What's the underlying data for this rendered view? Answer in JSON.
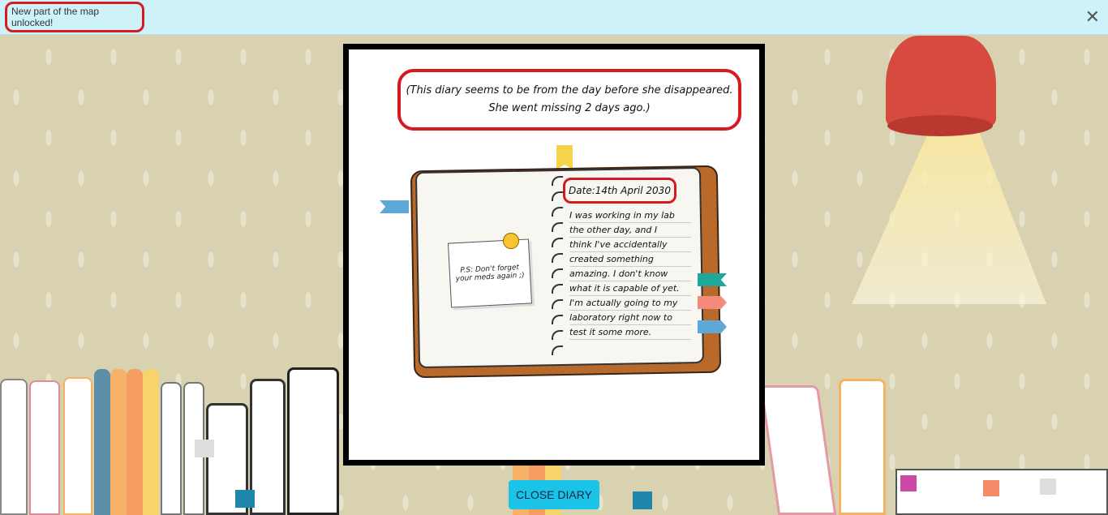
{
  "notification": {
    "text": "New part of the map unlocked!",
    "close_label": "✕"
  },
  "diary": {
    "intro_line1": "(This diary seems to be from the day before she disappeared.",
    "intro_line2": "She went missing 2 days ago.)",
    "sticky_note": "P.S: Don't forget your meds again ;)",
    "date": "Date:14th April 2030",
    "entry_lines": [
      "I was working in my lab",
      "the other day, and I",
      "think I've accidentally",
      "created something",
      "amazing. I don't know",
      "what it is capable of yet.",
      "I'm actually going to my",
      "laboratory right now to",
      "test it some more."
    ]
  },
  "buttons": {
    "close_diary": "CLOSE DIARY"
  },
  "colors": {
    "highlight": "#d71920",
    "banner_bg": "#cdf2f9",
    "button_bg": "#1bc3e8",
    "lamp": "#d64a40",
    "notebook_cover": "#b96a2a"
  }
}
